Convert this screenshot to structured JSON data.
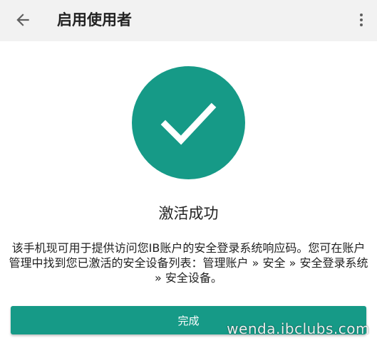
{
  "app_bar": {
    "title": "启用使用者",
    "back_icon": "arrow-left-icon",
    "overflow_icon": "more-vertical-icon"
  },
  "success": {
    "icon": "checkmark-icon",
    "title": "激活成功",
    "description": "该手机现可用于提供访问您IB账户的安全登录系统响应码。您可在账户管理中找到您已激活的安全设备列表：管理账户 » 安全 » 安全登录系统 » 安全设备。"
  },
  "actions": {
    "done_label": "完成"
  },
  "watermark": "wenda.ibclubs.com",
  "colors": {
    "accent": "#169a87",
    "app_bar_bg": "#f2f2f2"
  }
}
